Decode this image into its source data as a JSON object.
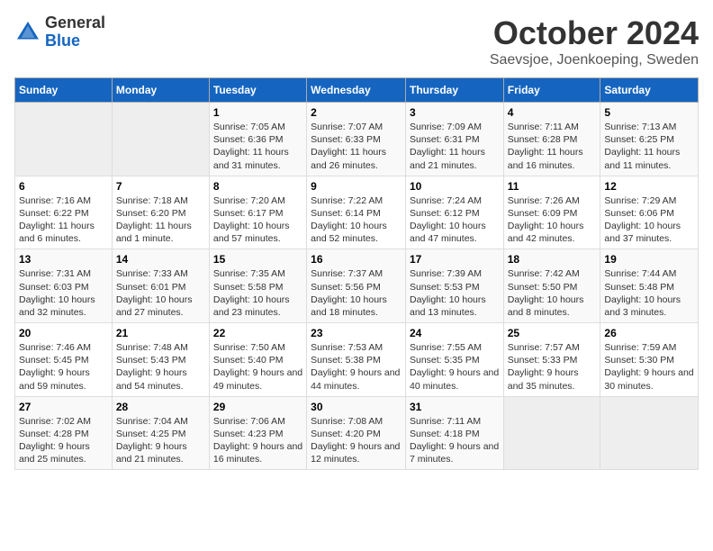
{
  "logo": {
    "general": "General",
    "blue": "Blue"
  },
  "title": "October 2024",
  "subtitle": "Saevsjoe, Joenkoeping, Sweden",
  "days_of_week": [
    "Sunday",
    "Monday",
    "Tuesday",
    "Wednesday",
    "Thursday",
    "Friday",
    "Saturday"
  ],
  "weeks": [
    [
      {
        "num": "",
        "detail": ""
      },
      {
        "num": "",
        "detail": ""
      },
      {
        "num": "1",
        "detail": "Sunrise: 7:05 AM\nSunset: 6:36 PM\nDaylight: 11 hours and 31 minutes."
      },
      {
        "num": "2",
        "detail": "Sunrise: 7:07 AM\nSunset: 6:33 PM\nDaylight: 11 hours and 26 minutes."
      },
      {
        "num": "3",
        "detail": "Sunrise: 7:09 AM\nSunset: 6:31 PM\nDaylight: 11 hours and 21 minutes."
      },
      {
        "num": "4",
        "detail": "Sunrise: 7:11 AM\nSunset: 6:28 PM\nDaylight: 11 hours and 16 minutes."
      },
      {
        "num": "5",
        "detail": "Sunrise: 7:13 AM\nSunset: 6:25 PM\nDaylight: 11 hours and 11 minutes."
      }
    ],
    [
      {
        "num": "6",
        "detail": "Sunrise: 7:16 AM\nSunset: 6:22 PM\nDaylight: 11 hours and 6 minutes."
      },
      {
        "num": "7",
        "detail": "Sunrise: 7:18 AM\nSunset: 6:20 PM\nDaylight: 11 hours and 1 minute."
      },
      {
        "num": "8",
        "detail": "Sunrise: 7:20 AM\nSunset: 6:17 PM\nDaylight: 10 hours and 57 minutes."
      },
      {
        "num": "9",
        "detail": "Sunrise: 7:22 AM\nSunset: 6:14 PM\nDaylight: 10 hours and 52 minutes."
      },
      {
        "num": "10",
        "detail": "Sunrise: 7:24 AM\nSunset: 6:12 PM\nDaylight: 10 hours and 47 minutes."
      },
      {
        "num": "11",
        "detail": "Sunrise: 7:26 AM\nSunset: 6:09 PM\nDaylight: 10 hours and 42 minutes."
      },
      {
        "num": "12",
        "detail": "Sunrise: 7:29 AM\nSunset: 6:06 PM\nDaylight: 10 hours and 37 minutes."
      }
    ],
    [
      {
        "num": "13",
        "detail": "Sunrise: 7:31 AM\nSunset: 6:03 PM\nDaylight: 10 hours and 32 minutes."
      },
      {
        "num": "14",
        "detail": "Sunrise: 7:33 AM\nSunset: 6:01 PM\nDaylight: 10 hours and 27 minutes."
      },
      {
        "num": "15",
        "detail": "Sunrise: 7:35 AM\nSunset: 5:58 PM\nDaylight: 10 hours and 23 minutes."
      },
      {
        "num": "16",
        "detail": "Sunrise: 7:37 AM\nSunset: 5:56 PM\nDaylight: 10 hours and 18 minutes."
      },
      {
        "num": "17",
        "detail": "Sunrise: 7:39 AM\nSunset: 5:53 PM\nDaylight: 10 hours and 13 minutes."
      },
      {
        "num": "18",
        "detail": "Sunrise: 7:42 AM\nSunset: 5:50 PM\nDaylight: 10 hours and 8 minutes."
      },
      {
        "num": "19",
        "detail": "Sunrise: 7:44 AM\nSunset: 5:48 PM\nDaylight: 10 hours and 3 minutes."
      }
    ],
    [
      {
        "num": "20",
        "detail": "Sunrise: 7:46 AM\nSunset: 5:45 PM\nDaylight: 9 hours and 59 minutes."
      },
      {
        "num": "21",
        "detail": "Sunrise: 7:48 AM\nSunset: 5:43 PM\nDaylight: 9 hours and 54 minutes."
      },
      {
        "num": "22",
        "detail": "Sunrise: 7:50 AM\nSunset: 5:40 PM\nDaylight: 9 hours and 49 minutes."
      },
      {
        "num": "23",
        "detail": "Sunrise: 7:53 AM\nSunset: 5:38 PM\nDaylight: 9 hours and 44 minutes."
      },
      {
        "num": "24",
        "detail": "Sunrise: 7:55 AM\nSunset: 5:35 PM\nDaylight: 9 hours and 40 minutes."
      },
      {
        "num": "25",
        "detail": "Sunrise: 7:57 AM\nSunset: 5:33 PM\nDaylight: 9 hours and 35 minutes."
      },
      {
        "num": "26",
        "detail": "Sunrise: 7:59 AM\nSunset: 5:30 PM\nDaylight: 9 hours and 30 minutes."
      }
    ],
    [
      {
        "num": "27",
        "detail": "Sunrise: 7:02 AM\nSunset: 4:28 PM\nDaylight: 9 hours and 25 minutes."
      },
      {
        "num": "28",
        "detail": "Sunrise: 7:04 AM\nSunset: 4:25 PM\nDaylight: 9 hours and 21 minutes."
      },
      {
        "num": "29",
        "detail": "Sunrise: 7:06 AM\nSunset: 4:23 PM\nDaylight: 9 hours and 16 minutes."
      },
      {
        "num": "30",
        "detail": "Sunrise: 7:08 AM\nSunset: 4:20 PM\nDaylight: 9 hours and 12 minutes."
      },
      {
        "num": "31",
        "detail": "Sunrise: 7:11 AM\nSunset: 4:18 PM\nDaylight: 9 hours and 7 minutes."
      },
      {
        "num": "",
        "detail": ""
      },
      {
        "num": "",
        "detail": ""
      }
    ]
  ]
}
